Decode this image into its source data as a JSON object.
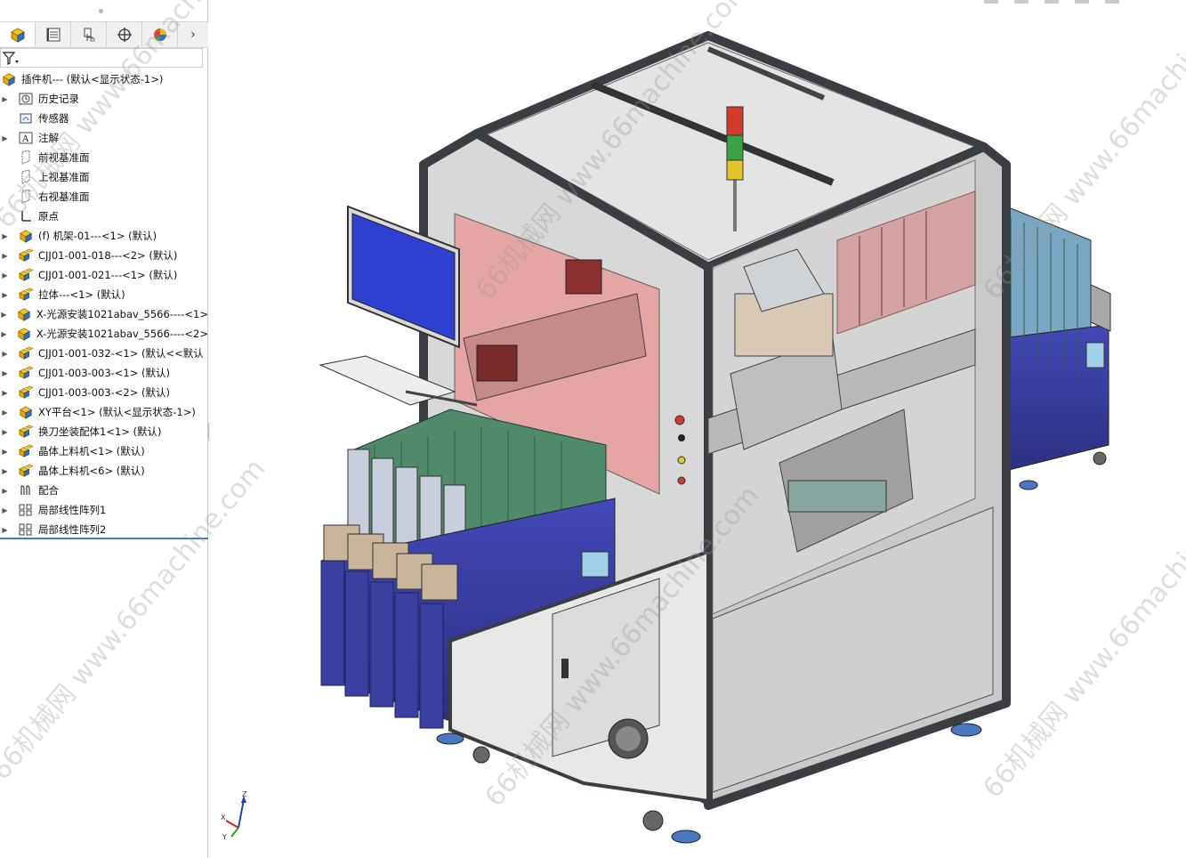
{
  "tabs": [
    {
      "name": "feature-manager",
      "icon": "assembly-icon"
    },
    {
      "name": "property-manager",
      "icon": "list-icon"
    },
    {
      "name": "configuration-manager",
      "icon": "config-icon"
    },
    {
      "name": "dimxpert-manager",
      "icon": "crosshair-icon"
    },
    {
      "name": "display-manager",
      "icon": "appearance-icon"
    }
  ],
  "tree": {
    "root_label": "插件机---  (默认<显示状态-1>)",
    "items": [
      {
        "label": "历史记录",
        "icon": "history-icon",
        "expandable": true
      },
      {
        "label": "传感器",
        "icon": "sensor-icon",
        "expandable": false
      },
      {
        "label": "注解",
        "icon": "annotation-icon",
        "expandable": true
      },
      {
        "label": "前视基准面",
        "icon": "plane-icon",
        "expandable": false
      },
      {
        "label": "上视基准面",
        "icon": "plane-icon",
        "expandable": false
      },
      {
        "label": "右视基准面",
        "icon": "plane-icon",
        "expandable": false
      },
      {
        "label": "原点",
        "icon": "origin-icon",
        "expandable": false
      },
      {
        "label": "(f) 机架-01---<1> (默认)",
        "icon": "part-icon",
        "expandable": true
      },
      {
        "label": "CJJ01-001-018---<2> (默认)",
        "icon": "subassembly-icon",
        "expandable": true
      },
      {
        "label": "CJJ01-001-021---<1> (默认)",
        "icon": "subassembly-icon",
        "expandable": true
      },
      {
        "label": "拉体---<1> (默认)",
        "icon": "subassembly-icon",
        "expandable": true
      },
      {
        "label": "X-光源安装1021abav_5566----<1>",
        "icon": "part-icon",
        "expandable": true
      },
      {
        "label": "X-光源安装1021abav_5566----<2>",
        "icon": "part-icon",
        "expandable": true
      },
      {
        "label": "CJJ01-001-032-<1> (默认<<默认",
        "icon": "subassembly-icon",
        "expandable": true
      },
      {
        "label": "CJJ01-003-003-<1> (默认)",
        "icon": "subassembly-icon",
        "expandable": true
      },
      {
        "label": "CJJ01-003-003-<2> (默认)",
        "icon": "subassembly-icon",
        "expandable": true
      },
      {
        "label": "XY平台<1> (默认<显示状态-1>)",
        "icon": "part-icon",
        "expandable": true
      },
      {
        "label": "换刀坐装配体1<1> (默认)",
        "icon": "subassembly-icon",
        "expandable": true
      },
      {
        "label": "晶体上料机<1> (默认)",
        "icon": "subassembly-icon",
        "expandable": true
      },
      {
        "label": "晶体上料机<6> (默认)",
        "icon": "subassembly-icon",
        "expandable": true
      },
      {
        "label": "配合",
        "icon": "mates-icon",
        "expandable": true
      },
      {
        "label": "局部线性阵列1",
        "icon": "pattern-icon",
        "expandable": true
      },
      {
        "label": "局部线性阵列2",
        "icon": "pattern-icon",
        "expandable": true
      }
    ]
  },
  "viewport": {
    "watermarks": [
      "66机械网 www.66machine.com"
    ],
    "triad_labels": {
      "z": "Z",
      "x": "X",
      "y": "Y"
    }
  },
  "colors": {
    "frame_dark": "#3a3d42",
    "panel_grey": "#d9d9d9",
    "glass_red": "#e8a0a0",
    "feeder_blue": "#3a3fa0",
    "pcb_green": "#4f8a6a",
    "monitor_blue": "#2f3fcf",
    "accent_blue": "#3b7fc4"
  }
}
